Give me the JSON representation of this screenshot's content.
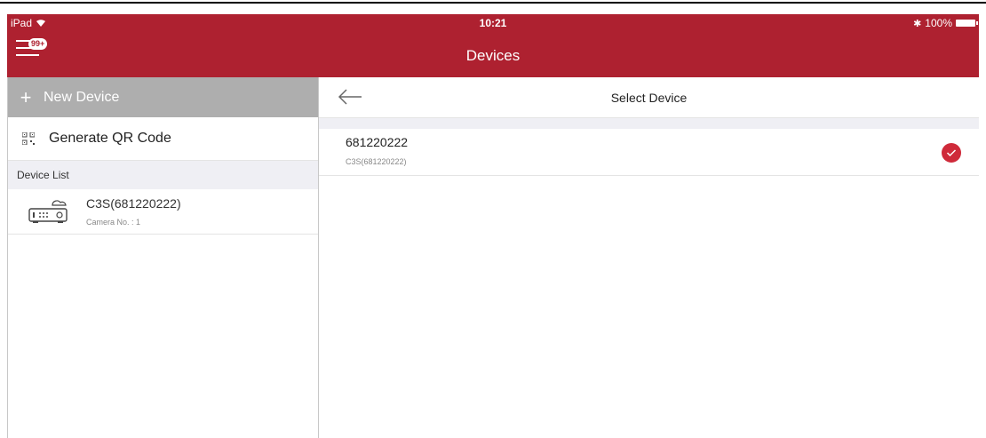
{
  "status_bar": {
    "device": "iPad",
    "time": "10:21",
    "battery": "100%"
  },
  "header": {
    "title": "Devices",
    "badge": "99+"
  },
  "sidebar": {
    "new_device_label": "New Device",
    "generate_qr_label": "Generate QR Code",
    "section_label": "Device List",
    "devices": [
      {
        "name": "C3S(681220222)",
        "sub": "Camera No. : 1"
      }
    ]
  },
  "panel": {
    "title": "Select Device",
    "items": [
      {
        "serial": "681220222",
        "model": "C3S(681220222)",
        "selected": true
      }
    ]
  },
  "colors": {
    "brand": "#ae2130",
    "accent_check": "#cf2a3a",
    "sidebar_button_bg": "#aeaeae"
  }
}
